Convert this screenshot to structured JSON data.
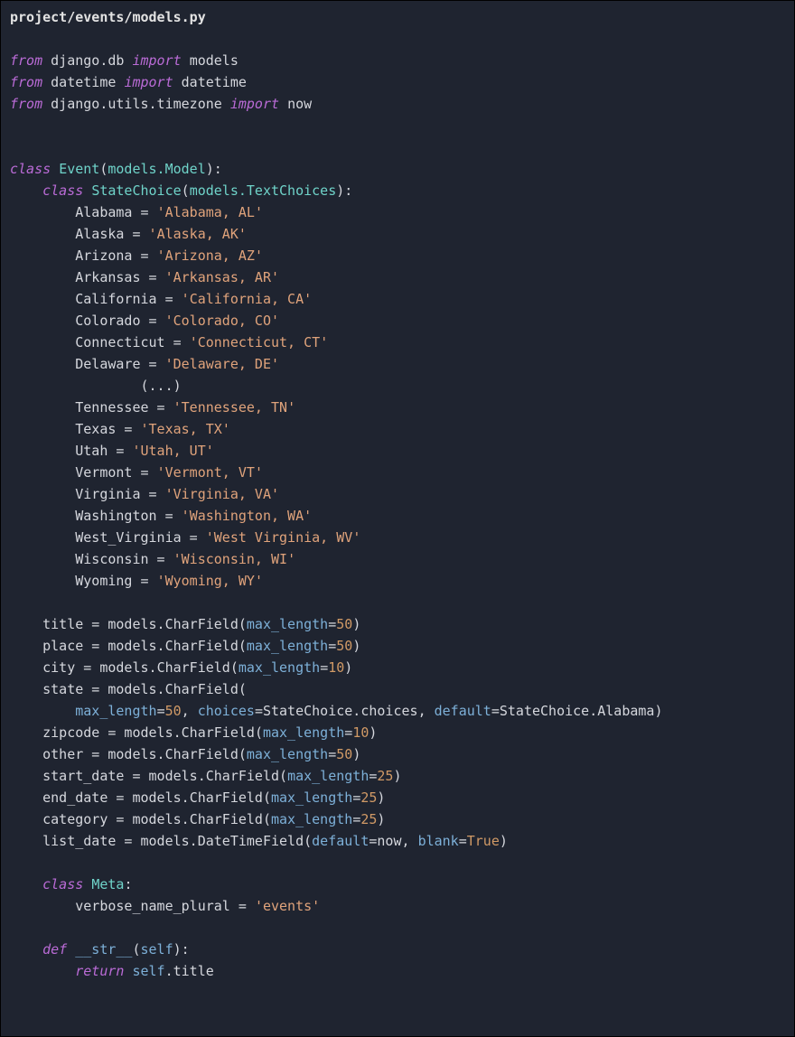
{
  "file_path": "project/events/models.py",
  "imports": [
    {
      "from": "django.db",
      "name": "models"
    },
    {
      "from": "datetime",
      "name": "datetime"
    },
    {
      "from": "django.utils.timezone",
      "name": "now"
    }
  ],
  "class_name": "Event",
  "class_base": "models.Model",
  "inner_class": "StateChoice",
  "inner_base": "models.TextChoices",
  "choices": [
    {
      "name": "Alabama",
      "value": "Alabama, AL"
    },
    {
      "name": "Alaska",
      "value": "Alaska, AK"
    },
    {
      "name": "Arizona",
      "value": "Arizona, AZ"
    },
    {
      "name": "Arkansas",
      "value": "Arkansas, AR"
    },
    {
      "name": "California",
      "value": "California, CA"
    },
    {
      "name": "Colorado",
      "value": "Colorado, CO"
    },
    {
      "name": "Connecticut",
      "value": "Connecticut, CT"
    },
    {
      "name": "Delaware",
      "value": "Delaware, DE"
    }
  ],
  "ellipsis": "(...)",
  "choices2": [
    {
      "name": "Tennessee",
      "value": "Tennessee, TN"
    },
    {
      "name": "Texas",
      "value": "Texas, TX"
    },
    {
      "name": "Utah",
      "value": "Utah, UT"
    },
    {
      "name": "Vermont",
      "value": "Vermont, VT"
    },
    {
      "name": "Virginia",
      "value": "Virginia, VA"
    },
    {
      "name": "Washington",
      "value": "Washington, WA"
    },
    {
      "name": "West_Virginia",
      "value": "West Virginia, WV"
    },
    {
      "name": "Wisconsin",
      "value": "Wisconsin, WI"
    },
    {
      "name": "Wyoming",
      "value": "Wyoming, WY"
    }
  ],
  "fields": {
    "title": {
      "type": "CharField",
      "max_length": 50
    },
    "place": {
      "type": "CharField",
      "max_length": 50
    },
    "city": {
      "type": "CharField",
      "max_length": 10
    },
    "state": {
      "type": "CharField",
      "ml": 50,
      "choices": "StateChoice.choices",
      "default": "StateChoice.Alabama"
    },
    "zipcode": {
      "type": "CharField",
      "max_length": 10
    },
    "other": {
      "type": "CharField",
      "max_length": 50
    },
    "start_date": {
      "type": "CharField",
      "max_length": 25
    },
    "end_date": {
      "type": "CharField",
      "max_length": 25
    },
    "category": {
      "type": "CharField",
      "max_length": 25
    },
    "list_date": {
      "type": "DateTimeField",
      "default": "now",
      "blank": "True"
    }
  },
  "meta": {
    "class": "Meta",
    "verbose_name_plural": "events"
  },
  "method": {
    "name": "__str__",
    "param": "self",
    "return": "self.title"
  },
  "kw": {
    "from": "from",
    "import": "import",
    "class": "class",
    "def": "def",
    "return": "return"
  }
}
